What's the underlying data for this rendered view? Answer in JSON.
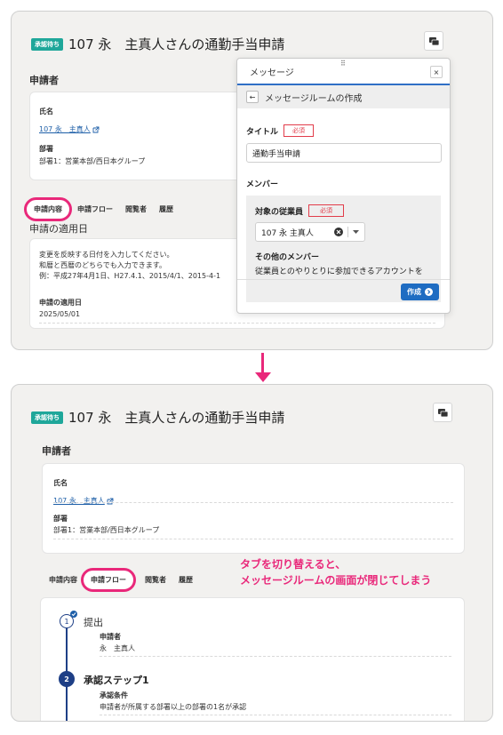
{
  "before": {
    "status_badge": "承認待ち",
    "title": "107 永　主真人さんの通勤手当申請",
    "applicant_section": "申請者",
    "name_label": "氏名",
    "name_value": "107 永　主真人",
    "dept_label": "部署",
    "dept_value": "部署1：営業本部/西日本グループ",
    "tabs": [
      "申請内容",
      "申請フロー",
      "閲覧者",
      "履歴"
    ],
    "active_tab": "申請内容",
    "apply_date_heading": "申請の適用日",
    "help_lines": [
      "変更を反映する日付を入力してください。",
      "和暦と西暦のどちらでも入力できます。",
      "例：平成27年4月1日、H27.4.1、2015/4/1、2015-4-1"
    ],
    "apply_date_label": "申請の適用日",
    "apply_date_value": "2025/05/01"
  },
  "modal": {
    "header": "メッセージ",
    "close": "×",
    "subheader": "メッセージルームの作成",
    "title_label": "タイトル",
    "required": "必須",
    "title_value": "通勤手当申請",
    "members_label": "メンバー",
    "target_label": "対象の従業員",
    "target_value": "107 永 主真人",
    "other_members_label": "その他のメンバー",
    "other_members_help": "従業員とのやりとりに参加できるアカウントを",
    "create_button": "作成"
  },
  "after": {
    "status_badge": "承認待ち",
    "title": "107 永　主真人さんの通勤手当申請",
    "applicant_section": "申請者",
    "name_label": "氏名",
    "name_value": "107 永　主真人",
    "dept_label": "部署",
    "dept_value": "部署1：営業本部/西日本グループ",
    "tabs": [
      "申請内容",
      "申請フロー",
      "閲覧者",
      "履歴"
    ],
    "active_tab": "申請フロー",
    "step1_number": "1",
    "step1_title": "提出",
    "step1_applicant_label": "申請者",
    "step1_applicant_value": "永　主真人",
    "step2_number": "2",
    "step2_title": "承認ステップ1",
    "step2_condition_label": "承認条件",
    "step2_condition_value": "申請者が所属する部署以上の部署の1名が承認"
  },
  "annotation": {
    "line1": "タブを切り替えると、",
    "line2": "メッセージルームの画面が閉じてしまう"
  },
  "colors": {
    "accent_pink": "#e9287a",
    "badge_teal": "#1fa79a",
    "link_blue": "#1e5fa8",
    "button_blue": "#1e6cc2",
    "required_red": "#e23c4a"
  }
}
